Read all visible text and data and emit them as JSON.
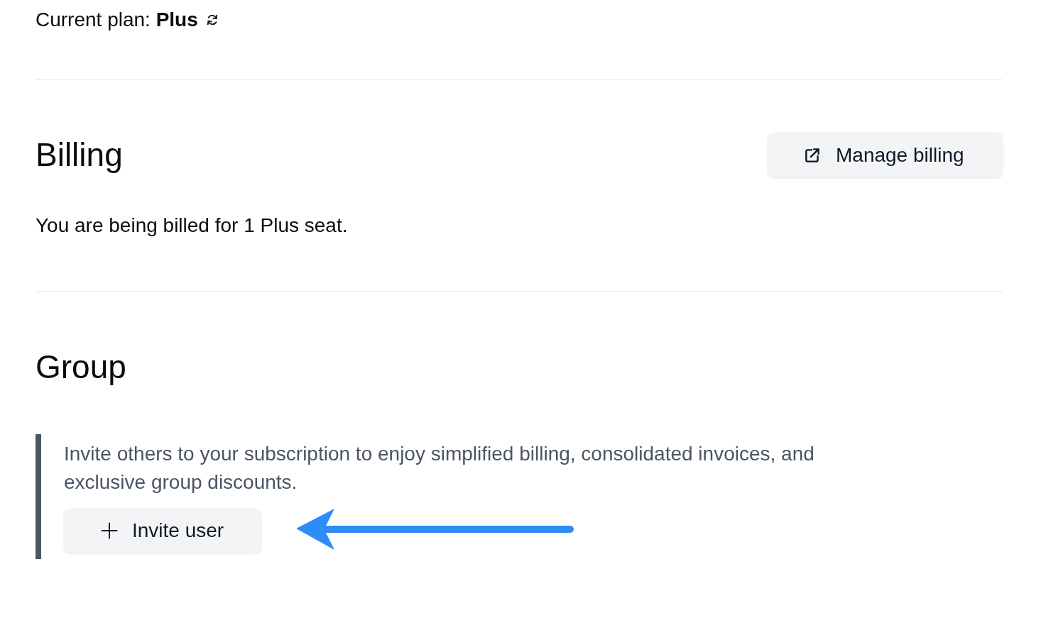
{
  "current_plan": {
    "text": "Current plan: **Plus**"
  },
  "billing": {
    "heading": "Billing",
    "button": "Manage billing",
    "summary": "You are being billed for 1 Plus seat."
  },
  "group": {
    "heading": "Group",
    "note": "Invite others to your subscription to enjoy simplified billing, consolidated invoices, and exclusive group discounts.",
    "button": "Invite user"
  }
}
